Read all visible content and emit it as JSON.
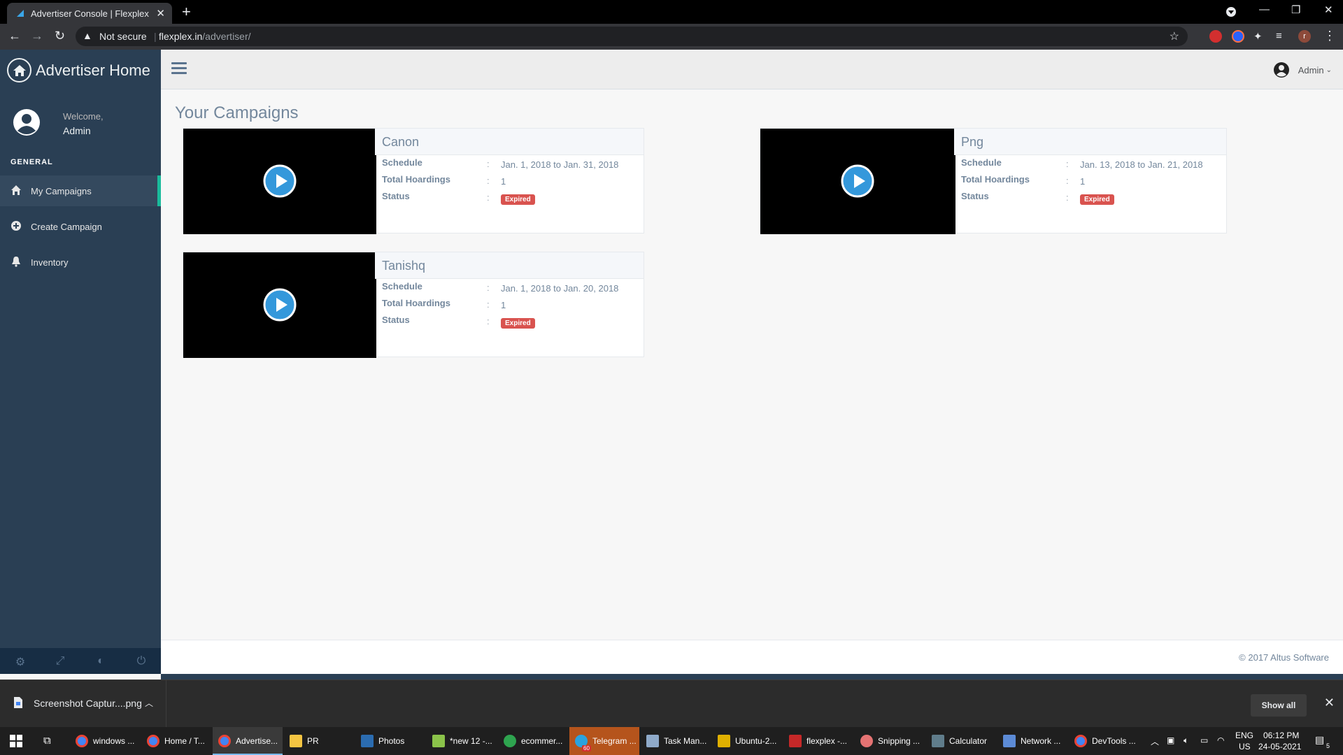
{
  "browser": {
    "tab_title": "Advertiser Console | Flexplex",
    "tab_close": "✕",
    "new_tab": "+",
    "security_label": "Not secure",
    "url_host": "flexplex.in",
    "url_path": "/advertiser/",
    "profile_initial": "r"
  },
  "sidebar": {
    "brand": "Advertiser Home",
    "welcome": "Welcome,",
    "user_name": "Admin",
    "section_title": "GENERAL",
    "items": [
      {
        "label": "My Campaigns",
        "icon": "home-icon",
        "active": true
      },
      {
        "label": "Create Campaign",
        "icon": "plus-circle-icon",
        "active": false
      },
      {
        "label": "Inventory",
        "icon": "bell-icon",
        "active": false
      }
    ]
  },
  "topnav": {
    "user_label": "Admin"
  },
  "main": {
    "page_title": "Your Campaigns",
    "field_labels": {
      "schedule": "Schedule",
      "hoardings": "Total Hoardings",
      "status": "Status"
    },
    "campaigns": [
      {
        "name": "Canon",
        "schedule": "Jan. 1, 2018 to Jan. 31, 2018",
        "hoardings": "1",
        "status": "Expired"
      },
      {
        "name": "Png",
        "schedule": "Jan. 13, 2018 to Jan. 21, 2018",
        "hoardings": "1",
        "status": "Expired"
      },
      {
        "name": "Tanishq",
        "schedule": "Jan. 1, 2018 to Jan. 20, 2018",
        "hoardings": "1",
        "status": "Expired"
      }
    ]
  },
  "footer": {
    "copyright": "© 2017 Altus Software"
  },
  "downloads": {
    "file_name": "Screenshot Captur....png",
    "show_all": "Show all"
  },
  "taskbar": {
    "apps": [
      {
        "label": "windows ...",
        "color": "#4285f4"
      },
      {
        "label": "Home / T...",
        "color": "#4285f4"
      },
      {
        "label": "Advertise...",
        "color": "#4285f4"
      },
      {
        "label": "PR",
        "color": "#f4c542"
      },
      {
        "label": "Photos",
        "color": "#2b6cb0"
      },
      {
        "label": "*new 12 -...",
        "color": "#8bc34a"
      },
      {
        "label": "ecommer...",
        "color": "#2ea44f"
      },
      {
        "label": "Telegram ...",
        "color": "#2aa3de"
      },
      {
        "label": "Task Man...",
        "color": "#8faac9"
      },
      {
        "label": "Ubuntu-2...",
        "color": "#e0b000"
      },
      {
        "label": "flexplex -...",
        "color": "#c62828"
      },
      {
        "label": "Snipping ...",
        "color": "#e57373"
      },
      {
        "label": "Calculator",
        "color": "#607d8b"
      },
      {
        "label": "Network ...",
        "color": "#5c8bd6"
      },
      {
        "label": "DevTools ...",
        "color": "#4285f4"
      }
    ],
    "telegram_badge": "60",
    "lang_top": "ENG",
    "lang_bottom": "US",
    "time": "06:12 PM",
    "date": "24-05-2021",
    "notifications": "5"
  },
  "colors": {
    "sidebar_bg": "#2a3f54",
    "accent": "#1abb9c",
    "badge_red": "#d9534f",
    "play_blue": "#3498db"
  }
}
